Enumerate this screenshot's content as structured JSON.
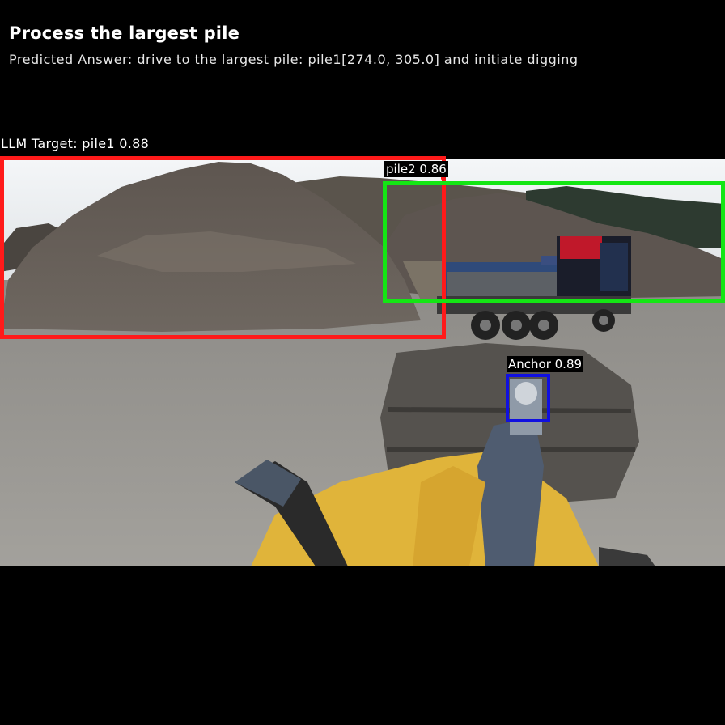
{
  "header": {
    "title": "Process the largest pile",
    "predicted_answer": "Predicted Answer: drive to the largest pile: pile1[274.0, 305.0] and initiate digging"
  },
  "llm_target": {
    "label": "LLM Target: pile1 0.88",
    "color": "#ff1a1a"
  },
  "detections": [
    {
      "label": "pile2 0.86",
      "color": "#14e614"
    },
    {
      "label": "Anchor 0.89",
      "color": "#1010e0"
    }
  ],
  "scene": {
    "objects": [
      "sky",
      "gravel-pile",
      "second-pile",
      "dump-truck",
      "loader-bucket",
      "loader-arm"
    ]
  }
}
